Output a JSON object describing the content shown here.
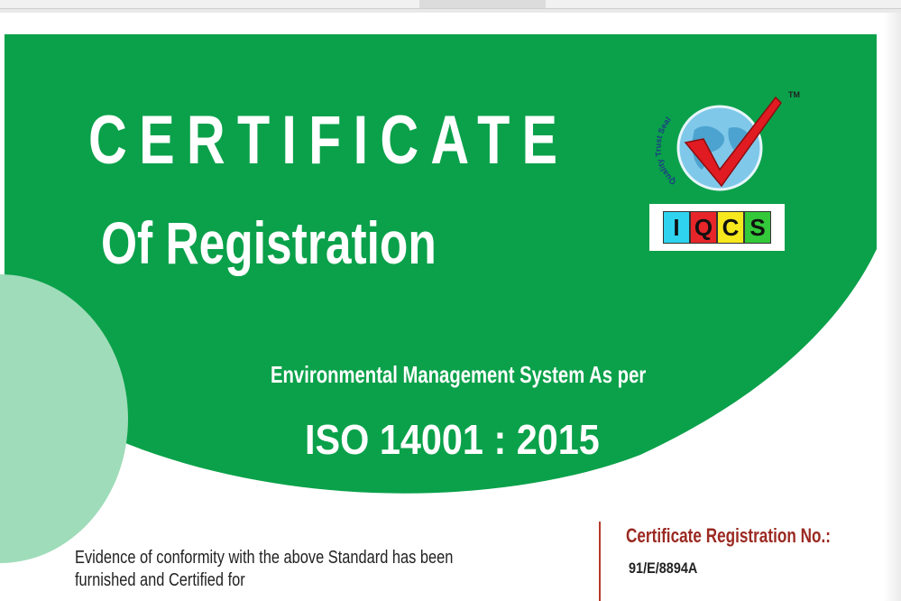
{
  "certificate": {
    "title": "CERTIFICATE",
    "subtitle": "Of Registration",
    "standard_intro": "Environmental Management System As per",
    "standard": "ISO 14001 : 2015",
    "evidence_line1": "Evidence of conformity with the above Standard has been",
    "evidence_line2": "furnished and Certified for",
    "registration_label": "Certificate Registration No.:",
    "registration_number": "91/E/8894A"
  },
  "logo": {
    "seal_text": "Quality Trust Seal",
    "trademark": "TM",
    "letters": [
      "I",
      "Q",
      "C",
      "S"
    ],
    "letter_colors": [
      "#2fd3f0",
      "#e8262a",
      "#f7e81d",
      "#33c93a"
    ],
    "icon_name": "globe-checkmark-icon"
  },
  "colors": {
    "primary_green": "#0aa14a",
    "light_green": "#9fdcb9",
    "accent_red": "#9b2a22"
  }
}
